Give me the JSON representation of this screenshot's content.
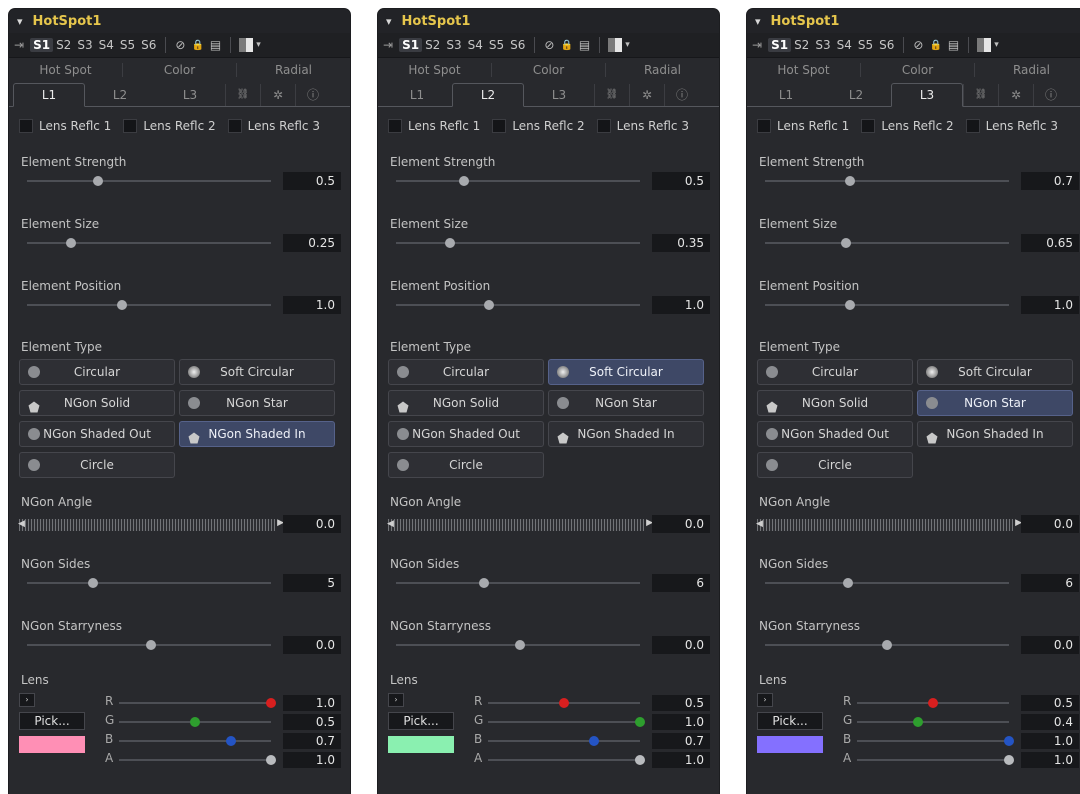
{
  "panels": [
    {
      "title": "HotSpot1",
      "slots": [
        "S1",
        "S2",
        "S3",
        "S4",
        "S5",
        "S6"
      ],
      "tabs_top": [
        "Hot Spot",
        "Color",
        "Radial"
      ],
      "tabs_sub": [
        "L1",
        "L2",
        "L3"
      ],
      "active_sub": 0,
      "checks": [
        "Lens Reflc 1",
        "Lens Reflc 2",
        "Lens Reflc 3"
      ],
      "sliders": [
        {
          "label": "Element Strength",
          "value": "0.5",
          "fraction": 0.29
        },
        {
          "label": "Element Size",
          "value": "0.25",
          "fraction": 0.18
        },
        {
          "label": "Element Position",
          "value": "1.0",
          "fraction": 0.39
        }
      ],
      "element_type_label": "Element Type",
      "types": [
        "Circular",
        "Soft Circular",
        "NGon Solid",
        "NGon Star",
        "NGon Shaded Out",
        "NGon Shaded In",
        "Circle"
      ],
      "active_type": 5,
      "ngon_angle": {
        "label": "NGon Angle",
        "value": "0.0"
      },
      "ngon_sides": {
        "label": "NGon Sides",
        "value": "5",
        "fraction": 0.27
      },
      "ngon_star": {
        "label": "NGon Starryness",
        "value": "0.0",
        "fraction": 0.51
      },
      "lens": {
        "label": "Lens",
        "pick": "Pick...",
        "color": "#ff8fb5",
        "channels": [
          {
            "name": "R",
            "value": "1.0",
            "fraction": 1.0,
            "knob": "#d81f1f"
          },
          {
            "name": "G",
            "value": "0.5",
            "fraction": 0.5,
            "knob": "#2e9e2e"
          },
          {
            "name": "B",
            "value": "0.7",
            "fraction": 0.74,
            "knob": "#2454c4"
          },
          {
            "name": "A",
            "value": "1.0",
            "fraction": 1.0,
            "knob": "#b9bbbe"
          }
        ]
      }
    },
    {
      "title": "HotSpot1",
      "slots": [
        "S1",
        "S2",
        "S3",
        "S4",
        "S5",
        "S6"
      ],
      "tabs_top": [
        "Hot Spot",
        "Color",
        "Radial"
      ],
      "tabs_sub": [
        "L1",
        "L2",
        "L3"
      ],
      "active_sub": 1,
      "checks": [
        "Lens Reflc 1",
        "Lens Reflc 2",
        "Lens Reflc 3"
      ],
      "sliders": [
        {
          "label": "Element Strength",
          "value": "0.5",
          "fraction": 0.28
        },
        {
          "label": "Element Size",
          "value": "0.35",
          "fraction": 0.22
        },
        {
          "label": "Element Position",
          "value": "1.0",
          "fraction": 0.38
        }
      ],
      "element_type_label": "Element Type",
      "types": [
        "Circular",
        "Soft Circular",
        "NGon Solid",
        "NGon Star",
        "NGon Shaded Out",
        "NGon Shaded In",
        "Circle"
      ],
      "active_type": 1,
      "ngon_angle": {
        "label": "NGon Angle",
        "value": "0.0"
      },
      "ngon_sides": {
        "label": "NGon Sides",
        "value": "6",
        "fraction": 0.36
      },
      "ngon_star": {
        "label": "NGon Starryness",
        "value": "0.0",
        "fraction": 0.51
      },
      "lens": {
        "label": "Lens",
        "pick": "Pick...",
        "color": "#8af0b0",
        "channels": [
          {
            "name": "R",
            "value": "0.5",
            "fraction": 0.5,
            "knob": "#d81f1f"
          },
          {
            "name": "G",
            "value": "1.0",
            "fraction": 1.0,
            "knob": "#2e9e2e"
          },
          {
            "name": "B",
            "value": "0.7",
            "fraction": 0.7,
            "knob": "#2454c4"
          },
          {
            "name": "A",
            "value": "1.0",
            "fraction": 1.0,
            "knob": "#b9bbbe"
          }
        ]
      }
    },
    {
      "title": "HotSpot1",
      "slots": [
        "S1",
        "S2",
        "S3",
        "S4",
        "S5",
        "S6"
      ],
      "tabs_top": [
        "Hot Spot",
        "Color",
        "Radial"
      ],
      "tabs_sub": [
        "L1",
        "L2",
        "L3"
      ],
      "active_sub": 2,
      "checks": [
        "Lens Reflc 1",
        "Lens Reflc 2",
        "Lens Reflc 3"
      ],
      "sliders": [
        {
          "label": "Element Strength",
          "value": "0.7",
          "fraction": 0.35
        },
        {
          "label": "Element Size",
          "value": "0.65",
          "fraction": 0.33
        },
        {
          "label": "Element Position",
          "value": "1.0",
          "fraction": 0.35
        }
      ],
      "element_type_label": "Element Type",
      "types": [
        "Circular",
        "Soft Circular",
        "NGon Solid",
        "NGon Star",
        "NGon Shaded Out",
        "NGon Shaded In",
        "Circle"
      ],
      "active_type": 3,
      "ngon_angle": {
        "label": "NGon Angle",
        "value": "0.0"
      },
      "ngon_sides": {
        "label": "NGon Sides",
        "value": "6",
        "fraction": 0.34
      },
      "ngon_star": {
        "label": "NGon Starryness",
        "value": "0.0",
        "fraction": 0.5
      },
      "lens": {
        "label": "Lens",
        "pick": "Pick...",
        "color": "#8470ff",
        "channels": [
          {
            "name": "R",
            "value": "0.5",
            "fraction": 0.5,
            "knob": "#d81f1f"
          },
          {
            "name": "G",
            "value": "0.4",
            "fraction": 0.4,
            "knob": "#2e9e2e"
          },
          {
            "name": "B",
            "value": "1.0",
            "fraction": 1.0,
            "knob": "#2454c4"
          },
          {
            "name": "A",
            "value": "1.0",
            "fraction": 1.0,
            "knob": "#b9bbbe"
          }
        ]
      }
    }
  ]
}
